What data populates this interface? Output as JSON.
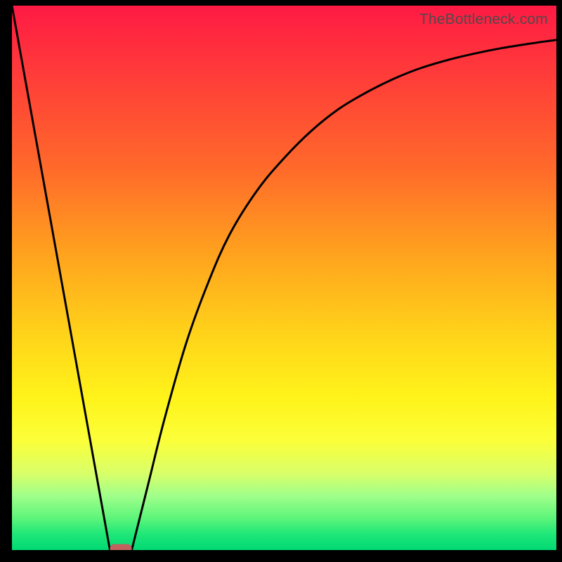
{
  "watermark": "TheBottleneck.com",
  "chart_data": {
    "type": "line",
    "title": "",
    "xlabel": "",
    "ylabel": "",
    "xlim": [
      0,
      100
    ],
    "ylim": [
      0,
      100
    ],
    "grid": false,
    "legend": false,
    "series": [
      {
        "name": "left-line",
        "x": [
          0,
          18
        ],
        "y": [
          100,
          0
        ]
      },
      {
        "name": "right-curve",
        "x": [
          22,
          25,
          28,
          32,
          36,
          40,
          45,
          50,
          55,
          60,
          65,
          70,
          75,
          80,
          85,
          90,
          95,
          100
        ],
        "y": [
          0,
          12,
          24,
          38,
          49,
          58,
          66,
          72,
          77,
          81,
          84,
          86.5,
          88.5,
          90,
          91.2,
          92.2,
          93,
          93.7
        ]
      }
    ],
    "marker": {
      "name": "bottleneck-marker",
      "x_range": [
        18,
        22
      ],
      "y": 0,
      "color": "#c1625e"
    },
    "background_gradient": {
      "top": "#ff1a44",
      "bottom": "#00d874"
    }
  }
}
